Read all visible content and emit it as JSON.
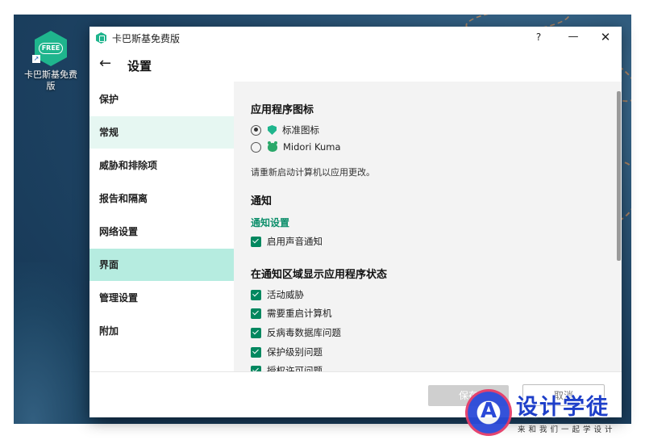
{
  "desktop": {
    "shortcut": {
      "icon_text": "FREE",
      "label": "卡巴斯基免费版"
    }
  },
  "window": {
    "title": "卡巴斯基免费版",
    "help": "?",
    "minimize": "—",
    "close": "✕"
  },
  "header": {
    "back": "←",
    "title": "设置"
  },
  "sidebar": {
    "items": [
      {
        "label": "保护"
      },
      {
        "label": "常规"
      },
      {
        "label": "威胁和排除项"
      },
      {
        "label": "报告和隔离"
      },
      {
        "label": "网络设置"
      },
      {
        "label": "界面"
      },
      {
        "label": "管理设置"
      },
      {
        "label": "附加"
      }
    ],
    "hovered": "常规",
    "selected": "界面"
  },
  "content": {
    "app_icon_section": {
      "heading": "应用程序图标",
      "options": [
        {
          "label": "标准图标",
          "selected": true,
          "icon": "shield-icon"
        },
        {
          "label": "Midori Kuma",
          "selected": false,
          "icon": "bear-icon"
        }
      ],
      "note": "请重新启动计算机以应用更改。"
    },
    "notification_section": {
      "heading": "通知",
      "link": "通知设置",
      "sound_checkbox": {
        "label": "启用声音通知",
        "checked": true
      }
    },
    "tray_section": {
      "heading": "在通知区域显示应用程序状态",
      "items": [
        {
          "label": "活动威胁",
          "checked": true
        },
        {
          "label": "需要重启计算机",
          "checked": true
        },
        {
          "label": "反病毒数据库问题",
          "checked": true
        },
        {
          "label": "保护级别问题",
          "checked": true
        },
        {
          "label": "授权许可问题",
          "checked": true
        }
      ]
    }
  },
  "footer": {
    "save": "保存",
    "cancel": "取消"
  },
  "watermark": {
    "letter": "A",
    "title": "设计学徒",
    "subtitle": "来和我们一起学设计"
  },
  "colors": {
    "accent": "#00875f",
    "nav_selected": "#b6ece0",
    "nav_hover": "#e6f7f2",
    "content_bg": "#f3f3f3"
  }
}
